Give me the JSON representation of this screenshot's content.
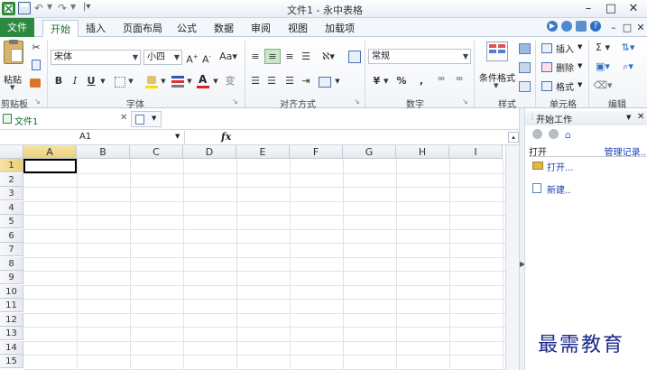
{
  "titlebar": {
    "title": "文件1 - 永中表格",
    "minimize": "–",
    "restore": "□",
    "close": "✕"
  },
  "tabs": [
    "文件",
    "开始",
    "插入",
    "页面布局",
    "公式",
    "数据",
    "审阅",
    "视图",
    "加载项"
  ],
  "ribbon": {
    "paste": "粘贴",
    "font_name": "宋体",
    "font_size": "小四",
    "bold": "B",
    "italic": "I",
    "underline": "U",
    "number_format": "常规",
    "percent": "%",
    "comma": ",",
    "cond_format": "条件格式",
    "insert": "插入",
    "delete": "删除",
    "format": "格式",
    "groups": {
      "clipboard": "剪贴板",
      "font": "字体",
      "alignment": "对齐方式",
      "number": "数字",
      "style": "样式",
      "cells": "单元格",
      "edit": "编辑"
    }
  },
  "document": {
    "tab_name": "文件1",
    "close": "✕"
  },
  "formula_bar": {
    "name_box": "A1",
    "fx": "fx"
  },
  "grid": {
    "columns": [
      "A",
      "B",
      "C",
      "D",
      "E",
      "F",
      "G",
      "H",
      "I"
    ],
    "rows": [
      "1",
      "2",
      "3",
      "4",
      "5",
      "6",
      "7",
      "8",
      "9",
      "10",
      "11",
      "12",
      "13",
      "14",
      "15"
    ],
    "selected_cell": "A1"
  },
  "task_pane": {
    "title": "开始工作",
    "section": "打开",
    "manage": "管理记录..",
    "open": "打开...",
    "new": "新建..",
    "close": "✕",
    "dropdown": "▼"
  },
  "watermark": "最需教育",
  "colors": {
    "file_tab": "#2b8a3e",
    "home_tab_text": "#1a6b2c",
    "selection": "#000000",
    "watermark": "#1b2a8a"
  }
}
